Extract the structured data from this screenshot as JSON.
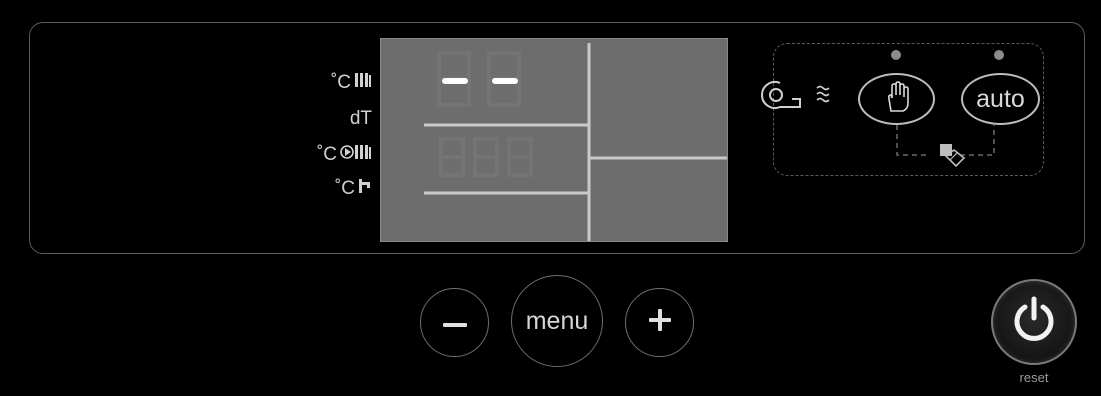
{
  "labels": {
    "row1_unit": "˚C",
    "row1_icon": "radiator-icon",
    "row2_text": "dT",
    "row3_unit": "˚C",
    "row3_icon": "pump-radiator-icon",
    "row4_unit": "˚C",
    "row4_icon": "tap-icon"
  },
  "controls": {
    "menu_label": "menu",
    "minus_icon": "minus-icon",
    "plus_icon": "plus-icon",
    "power_icon": "power-icon",
    "reset_label": "reset"
  },
  "mode": {
    "hand_icon": "hand-icon",
    "auto_label": "auto",
    "boiler_icon": "boiler-flame-icon",
    "valve_icon": "valve-icon"
  },
  "lcd": {
    "top_digits": "-.-",
    "bottom_digits": "888"
  },
  "colors": {
    "background": "#000000",
    "lcd": "#6d6d6d",
    "outline": "#5b5b5b",
    "text": "#cfcfcf"
  }
}
